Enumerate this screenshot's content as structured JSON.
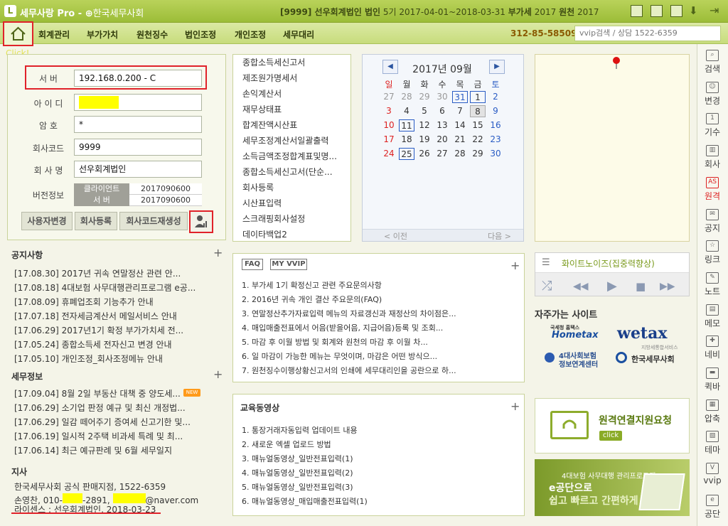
{
  "titlebar": {
    "logo": "L",
    "app_name": "세무사랑 Pro",
    "org": "한국세무사회",
    "company_code": "[9999] 선우회계법인 법인",
    "period": "5기 2017-04-01~2018-03-31",
    "vat_label": "부가세",
    "vat_year": "2017",
    "wh_label": "원천",
    "wh_year": "2017"
  },
  "menu": {
    "click_hint": "Click!",
    "items": [
      "회계관리",
      "부가가치",
      "원천징수",
      "법인조정",
      "개인조정",
      "세무대리"
    ],
    "biz_no": "312-85-58509",
    "search_placeholder": "vvip검색 / 상담 1522-6359"
  },
  "login": {
    "server_label": "서   버",
    "server_value": "192.168.0.200 - C",
    "id_label": "아 이 디",
    "pw_label": "암     호",
    "pw_value": "*",
    "code_label": "회사코드",
    "code_value": "9999",
    "name_label": "회 사 명",
    "name_value": "선우회계법인",
    "ver_label": "버전정보",
    "client_label": "클라이언트",
    "client_ver": "2017090600",
    "srv_label": "서    버",
    "srv_ver": "2017090600",
    "btn_user": "사용자변경",
    "btn_reg": "회사등록",
    "btn_regen": "회사코드재생성"
  },
  "notice": {
    "title": "공지사항",
    "items": [
      "[17.08.30] 2017년 귀속 연말정산 관련 안...",
      "[17.08.18] 4대보험 사무대행관리프로그램 e공...",
      "[17.08.09] 휴폐업조회 기능추가 안내",
      "[17.07.18] 전자세금계산서 메일서비스 안내",
      "[17.06.29] 2017년1기 확정 부가가치세 전...",
      "[17.05.24] 종합소득세 전자신고 변경 안내",
      "[17.05.10] 개인조정_회사조정메뉴 안내"
    ]
  },
  "taxinfo": {
    "title": "세무정보",
    "new_badge": "NEW",
    "items": [
      "[17.09.04] 8월 2일 부동산 대책 중 양도세...",
      "[17.06.29] 소기업 판정 예규 및 최신 개정법...",
      "[17.06.29] 일감 떼어주기 증여세 신고기한 및...",
      "[17.06.19] 일시적 2주택 비과세 특례 및 최...",
      "[17.06.14] 최근 예규판례 및 6월 세무일지"
    ]
  },
  "branch": {
    "title": "지사",
    "line1": "한국세무사회 공식 판매지점, 1522-6359",
    "line2_a": "손영찬, 010-",
    "line2_b": "-2891,",
    "line2_c": "@naver.com",
    "license": "라이센스 : 선우회계법인, 2018-03-23"
  },
  "menulist": [
    "종합소득세신고서",
    "제조원가명세서",
    "손익계산서",
    "재무상태표",
    "합계잔액시산표",
    "세무조정계산서일괄출력",
    "소득금액조정합계표및명...",
    "종합소득세신고서(단순...",
    "회사등록",
    "시산표입력",
    "스크래핑회사설정",
    "데이타백업2"
  ],
  "calendar": {
    "title": "2017년 09월",
    "prev": "◀",
    "next": "▶",
    "weekdays": [
      "일",
      "월",
      "화",
      "수",
      "목",
      "금",
      "토"
    ],
    "weeks": [
      [
        "27",
        "28",
        "29",
        "30",
        "31",
        "1",
        "2"
      ],
      [
        "3",
        "4",
        "5",
        "6",
        "7",
        "8",
        "9"
      ],
      [
        "10",
        "11",
        "12",
        "13",
        "14",
        "15",
        "16"
      ],
      [
        "17",
        "18",
        "19",
        "20",
        "21",
        "22",
        "23"
      ],
      [
        "24",
        "25",
        "26",
        "27",
        "28",
        "29",
        "30"
      ]
    ],
    "footer_prev": "< 이전",
    "footer_next": "다음 >"
  },
  "faq": {
    "tab1": "FAQ",
    "tab2": "MY VVIP",
    "items": [
      "1. 부가세 1기 확정신고 관련 주요문의사항",
      "2. 2016년 귀속 개인 결산 주요문의(FAQ)",
      "3. 연말정산추가자료입력 메뉴의 자료갱신과 재정산의 차이점은...",
      "4. 매입매출전표에서 어음(받을어음, 지급어음)등록 및 조회...",
      "5. 마감 후 이월 방법 및 회계와 원천의 마감 후 이월 차...",
      "6. 일 마감이 가능한 메뉴는 무엇이며, 마감은 어떤 방식으...",
      "7. 원천징수이행상황신고서의 인쇄에 세무대리인을 공란으로 하..."
    ]
  },
  "edu": {
    "title": "교육동영상",
    "items": [
      "1. 통장거래자동입력 업데이트 내용",
      "2. 새로운 엑셀 업로드 방법",
      "3. 매뉴얼동영상_일반전표입력(1)",
      "4. 매뉴얼동영상_일반전표입력(2)",
      "5. 매뉴얼동영상_일반전표입력(3)",
      "6. 매뉴얼동영상_매입매출전표입력(1)"
    ]
  },
  "music": {
    "title": "화이트노이즈(집중력향상)",
    "shuffle": "⤮",
    "prev": "◀◀",
    "play": "▶",
    "stop": "■",
    "next": "▶▶"
  },
  "sites": {
    "title": "자주가는 사이트",
    "hometax": "Hometax",
    "hometax_sub": "국세청 홈택스",
    "wetax": "wetax",
    "wetax_sub": "지방세통합서비스",
    "insurance1": "4대사회보험",
    "insurance2": "정보연계센터",
    "kacpta": "한국세무사회"
  },
  "remote": {
    "title": "원격연결지원요청",
    "button": "click"
  },
  "banner": {
    "line1": "4대보험 사무대행 관리프로그램",
    "line2": "e공단으로",
    "line3": "쉽고 빠르고 간편하게"
  },
  "sidebar": [
    {
      "label": "검색",
      "icon": "search-icon"
    },
    {
      "label": "변경",
      "icon": "users-icon"
    },
    {
      "label": "기수",
      "icon": "calendar-icon"
    },
    {
      "label": "회사",
      "icon": "building-icon"
    },
    {
      "label": "원격",
      "icon": "remote-icon"
    },
    {
      "label": "공지",
      "icon": "notice-icon"
    },
    {
      "label": "링크",
      "icon": "star-icon"
    },
    {
      "label": "노트",
      "icon": "note-icon"
    },
    {
      "label": "메모",
      "icon": "memo-icon"
    },
    {
      "label": "네비",
      "icon": "navi-icon"
    },
    {
      "label": "퀵바",
      "icon": "quickbar-icon"
    },
    {
      "label": "압축",
      "icon": "compress-icon"
    },
    {
      "label": "테마",
      "icon": "theme-icon"
    },
    {
      "label": "vvip",
      "icon": "vvip-icon"
    },
    {
      "label": "공단",
      "icon": "gongdan-icon"
    }
  ]
}
